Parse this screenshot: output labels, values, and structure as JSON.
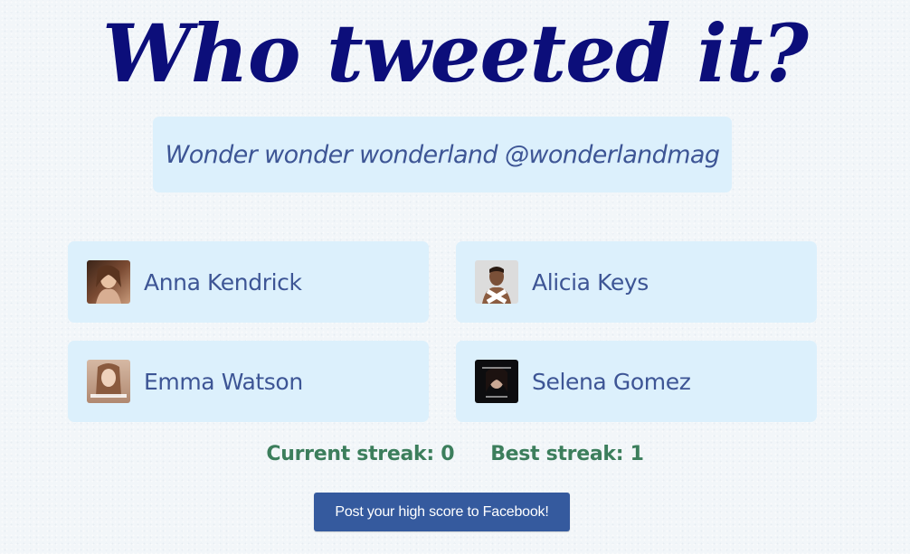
{
  "title": "Who tweeted it?",
  "tweet": {
    "text": "Wonder wonder wonderland @wonderlandmag"
  },
  "choices": [
    {
      "name": "Anna Kendrick",
      "avatar_icon": "anna-kendrick-avatar"
    },
    {
      "name": "Alicia Keys",
      "avatar_icon": "alicia-keys-avatar"
    },
    {
      "name": "Emma Watson",
      "avatar_icon": "emma-watson-avatar"
    },
    {
      "name": "Selena Gomez",
      "avatar_icon": "selena-gomez-avatar"
    }
  ],
  "streaks": {
    "current_label": "Current streak: 0",
    "best_label": "Best streak: 1"
  },
  "facebook_button": {
    "label": "Post your high score to Facebook!"
  },
  "colors": {
    "title": "#0c0e7a",
    "card_background": "#dcf0fc",
    "card_text": "#3d5595",
    "streak_text": "#3c7e5c",
    "facebook_button": "#355a9e"
  }
}
